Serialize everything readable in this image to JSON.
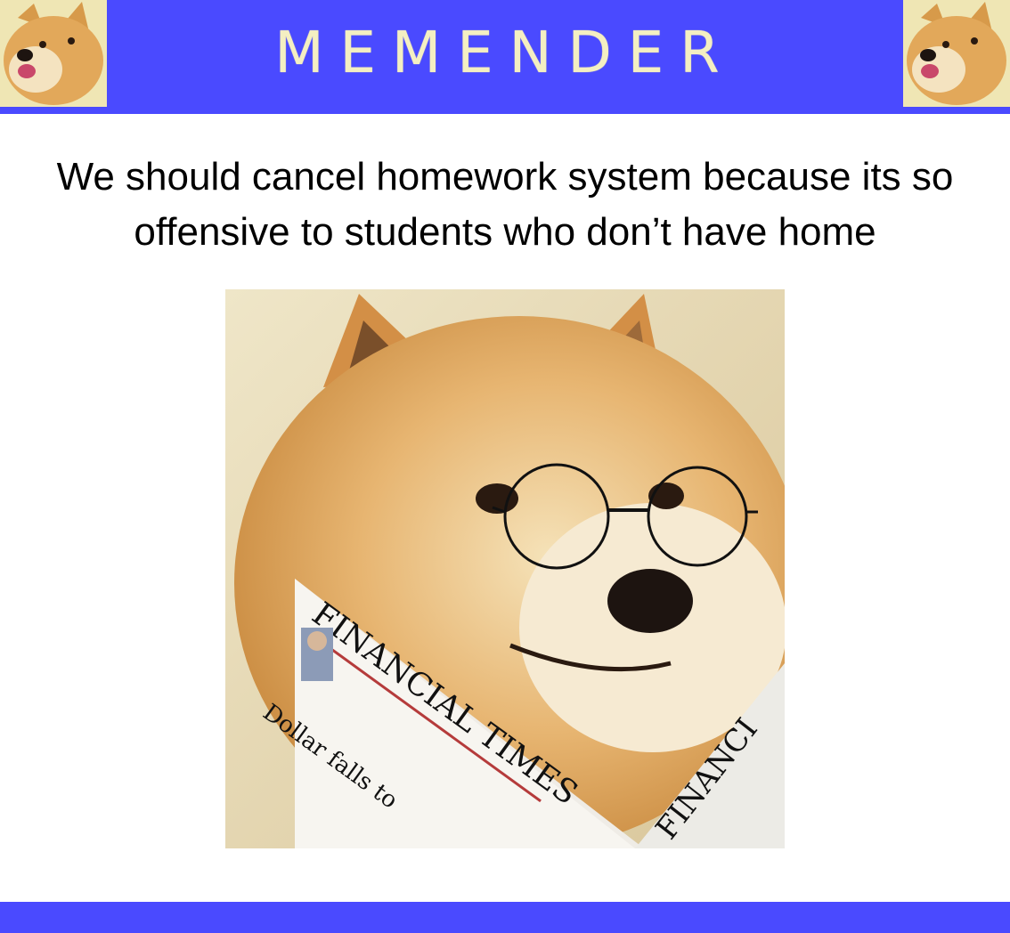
{
  "header": {
    "brand": "MEMENDER",
    "avatar_icon": "doge-icon"
  },
  "meme": {
    "caption_line1": "We should cancel homework system because its so",
    "caption_line2": "offensive to students who don’t have home",
    "newspaper_masthead": "FINANCIAL TIMES",
    "newspaper_headline": "Dollar falls to",
    "newspaper_masthead_right": "FINANCI"
  },
  "colors": {
    "brand_blue": "#4a4aff",
    "brand_text": "#f4efc2"
  }
}
